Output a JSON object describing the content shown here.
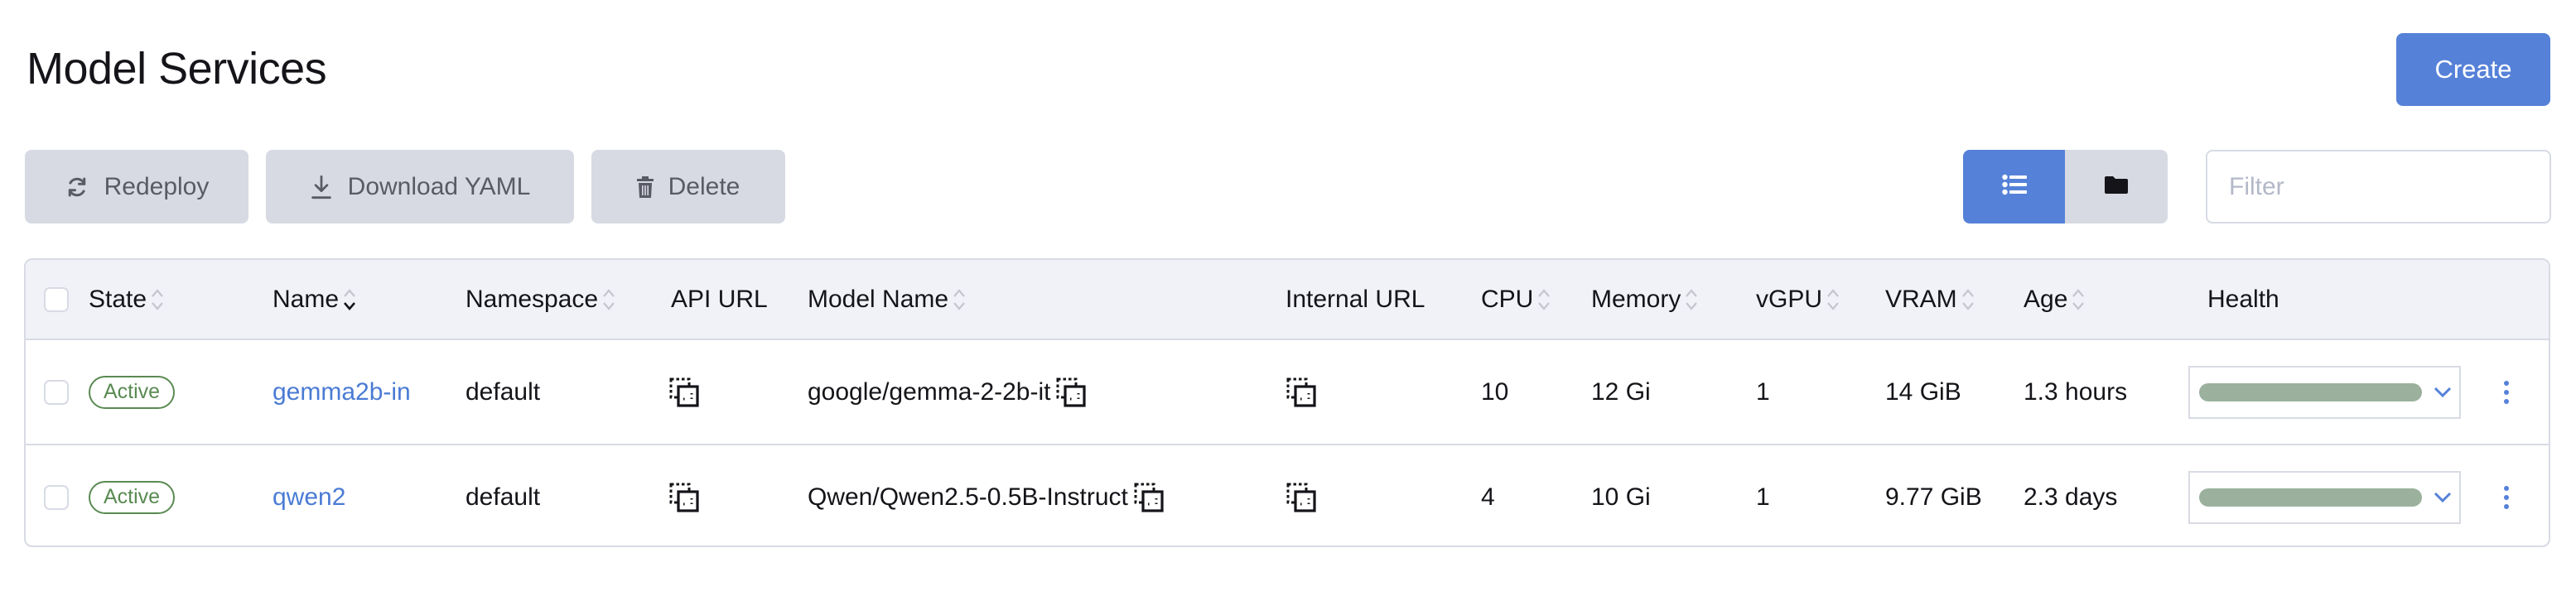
{
  "page": {
    "title": "Model Services",
    "create_label": "Create"
  },
  "toolbar": {
    "redeploy_label": "Redeploy",
    "download_yaml_label": "Download YAML",
    "delete_label": "Delete",
    "view_toggle": {
      "options": [
        {
          "icon": "list-icon",
          "active": true
        },
        {
          "icon": "folder-icon",
          "active": false
        }
      ]
    },
    "filter": {
      "placeholder": "Filter",
      "value": ""
    }
  },
  "colors": {
    "primary": "#5581d8",
    "secondary_button": "#d7dae3",
    "active_badge": "#5a8a52",
    "health_bar": "#9bb19d",
    "link": "#4a7bd4"
  },
  "table": {
    "columns": [
      {
        "key": "state",
        "label": "State",
        "sortable": true
      },
      {
        "key": "name",
        "label": "Name",
        "sortable": true,
        "sort": "descending"
      },
      {
        "key": "namespace",
        "label": "Namespace",
        "sortable": true
      },
      {
        "key": "api_url",
        "label": "API URL",
        "sortable": false
      },
      {
        "key": "model_name",
        "label": "Model Name",
        "sortable": true
      },
      {
        "key": "internal_url",
        "label": "Internal URL",
        "sortable": false
      },
      {
        "key": "cpu",
        "label": "CPU",
        "sortable": true
      },
      {
        "key": "memory",
        "label": "Memory",
        "sortable": true
      },
      {
        "key": "vgpu",
        "label": "vGPU",
        "sortable": true
      },
      {
        "key": "vram",
        "label": "VRAM",
        "sortable": true
      },
      {
        "key": "age",
        "label": "Age",
        "sortable": true
      },
      {
        "key": "health",
        "label": "Health",
        "sortable": false
      }
    ],
    "rows": [
      {
        "state": "Active",
        "name": "gemma2b-in",
        "namespace": "default",
        "model_name": "google/gemma-2-2b-it",
        "cpu": "10",
        "memory": "12 Gi",
        "vgpu": "1",
        "vram": "14 GiB",
        "age": "1.3 hours",
        "health_fraction": 1.0
      },
      {
        "state": "Active",
        "name": "qwen2",
        "namespace": "default",
        "model_name": "Qwen/Qwen2.5-0.5B-Instruct",
        "cpu": "4",
        "memory": "10 Gi",
        "vgpu": "1",
        "vram": "9.77 GiB",
        "age": "2.3 days",
        "health_fraction": 1.0
      }
    ]
  }
}
